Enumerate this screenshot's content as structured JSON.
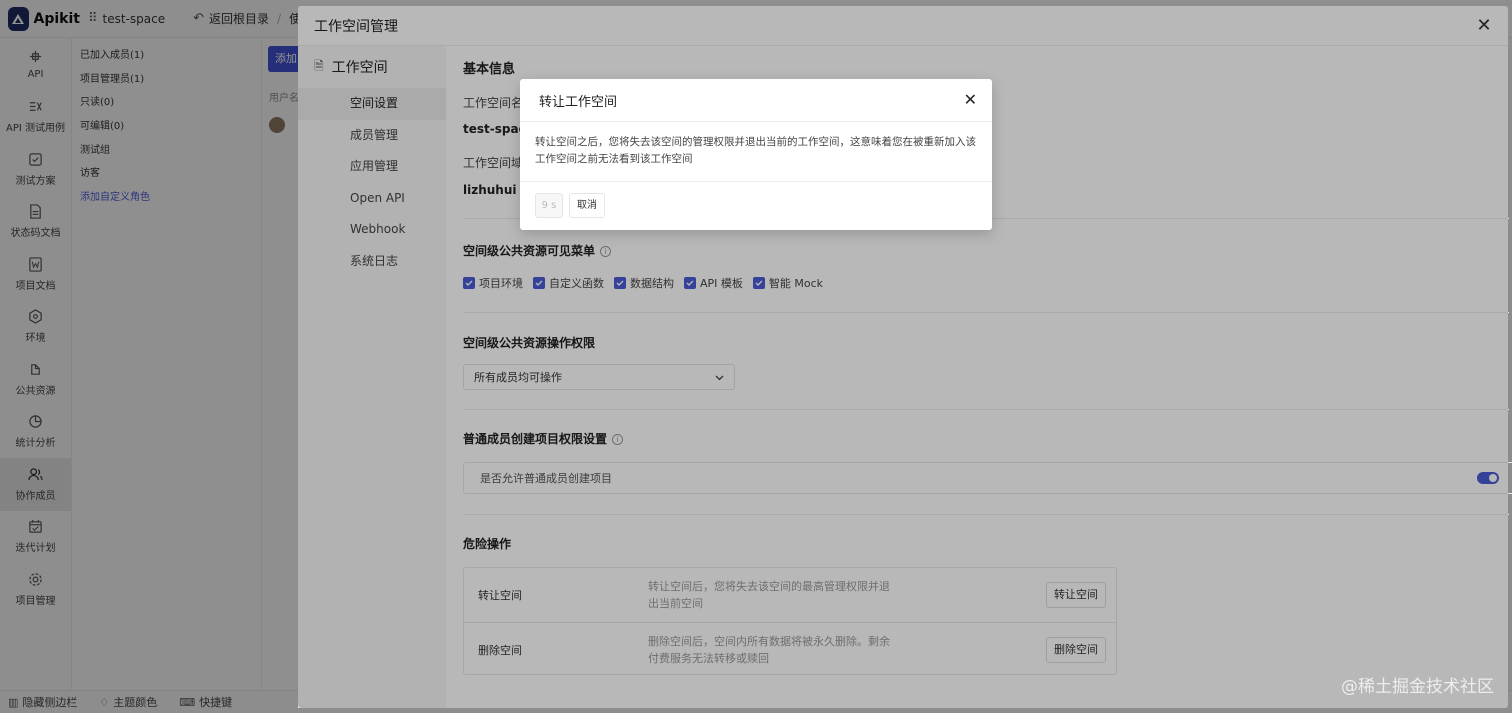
{
  "app": {
    "name": "Apikit",
    "workspace": "test-space",
    "back_label": "返回根目录",
    "top_trailing": "使用"
  },
  "leftnav": {
    "items": [
      {
        "label": "API",
        "icon": "api-icon"
      },
      {
        "label": "API 测试用例",
        "icon": "test-case-icon"
      },
      {
        "label": "测试方案",
        "icon": "test-plan-icon"
      },
      {
        "label": "状态码文档",
        "icon": "status-doc-icon"
      },
      {
        "label": "项目文档",
        "icon": "project-doc-icon"
      },
      {
        "label": "环境",
        "icon": "environment-icon"
      },
      {
        "label": "公共资源",
        "icon": "public-resource-icon"
      },
      {
        "label": "统计分析",
        "icon": "analytics-icon"
      },
      {
        "label": "协作成员",
        "icon": "members-icon"
      },
      {
        "label": "迭代计划",
        "icon": "iteration-icon"
      },
      {
        "label": "项目管理",
        "icon": "settings-icon"
      }
    ]
  },
  "roles": {
    "items": [
      "已加入成员(1)",
      "项目管理员(1)",
      "只读(0)",
      "可编辑(0)",
      "测试组",
      "访客"
    ],
    "add_label": "添加自定义角色"
  },
  "content_bg": {
    "add_button": "添加",
    "user_col": "用户名"
  },
  "bottombar": {
    "hide_sidebar": "隐藏侧边栏",
    "theme": "主题颜色",
    "shortcuts": "快捷键"
  },
  "drawer": {
    "title": "工作空间管理",
    "nav_title": "工作空间",
    "nav_items": [
      "空间设置",
      "成员管理",
      "应用管理",
      "Open API",
      "Webhook",
      "系统日志"
    ],
    "basic": {
      "title": "基本信息",
      "name_label": "工作空间名称",
      "name_value": "test-space",
      "domain_label": "工作空间域名",
      "domain_value": "lizhuhui .w"
    },
    "visible_menu": {
      "title": "空间级公共资源可见菜单",
      "options": [
        "项目环境",
        "自定义函数",
        "数据结构",
        "API 模板",
        "智能 Mock"
      ]
    },
    "permission": {
      "title": "空间级公共资源操作权限",
      "selected": "所有成员均可操作"
    },
    "create_project": {
      "title": "普通成员创建项目权限设置",
      "toggle_label": "是否允许普通成员创建项目",
      "enabled": true
    },
    "danger": {
      "title": "危险操作",
      "rows": [
        {
          "name": "转让空间",
          "desc": "转让空间后，您将失去该空间的最高管理权限并退出当前空间",
          "button": "转让空间"
        },
        {
          "name": "删除空间",
          "desc": "删除空间后，空间内所有数据将被永久删除。剩余付费服务无法转移或赎回",
          "button": "删除空间"
        }
      ]
    }
  },
  "dialog": {
    "title": "转让工作空间",
    "body": "转让空间之后，您将失去该空间的管理权限并退出当前的工作空间，这意味着您在被重新加入该工作空间之前无法看到该工作空间",
    "countdown": "9 s",
    "cancel": "取消"
  },
  "watermark": "@稀土掘金技术社区",
  "colors": {
    "accent": "#4b5bd6",
    "logo_bg": "#1f2a60"
  }
}
